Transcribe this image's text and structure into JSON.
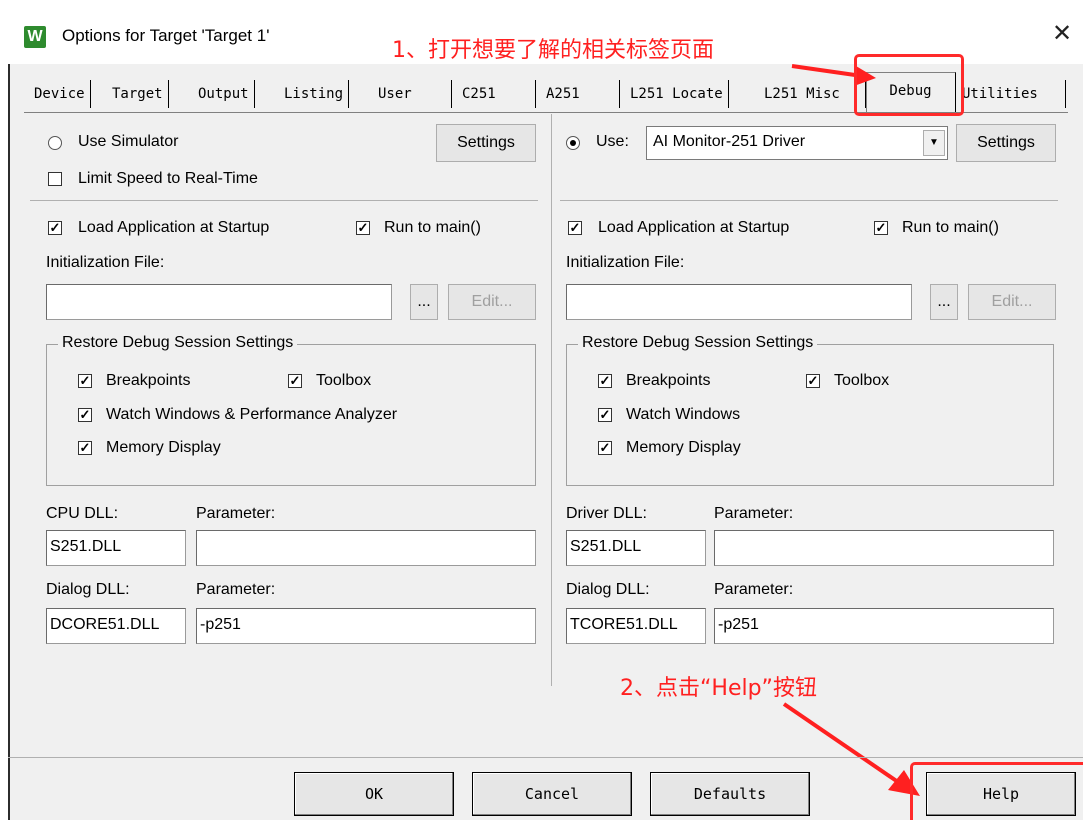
{
  "window": {
    "title": "Options for Target 'Target 1'",
    "icon": "W",
    "close_glyph": "✕"
  },
  "annotations": {
    "step1": "1、打开想要了解的相关标签页面",
    "step2": "2、点击“Help”按钮",
    "color": "#ff2020"
  },
  "tabs": [
    {
      "label": "Device"
    },
    {
      "label": "Target"
    },
    {
      "label": "Output"
    },
    {
      "label": "Listing"
    },
    {
      "label": "User"
    },
    {
      "label": "C251"
    },
    {
      "label": "A251"
    },
    {
      "label": "L251 Locate"
    },
    {
      "label": "L251 Misc"
    },
    {
      "label": "Debug",
      "active": true
    },
    {
      "label": "Utilities"
    }
  ],
  "left": {
    "use_simulator": "Use Simulator",
    "settings": "Settings",
    "limit_speed": "Limit Speed to Real-Time",
    "load_app": "Load Application at Startup",
    "run_to_main": "Run to main()",
    "init_file_label": "Initialization File:",
    "init_file_value": "",
    "browse": "...",
    "edit": "Edit...",
    "restore_group": "Restore Debug Session Settings",
    "breakpoints": "Breakpoints",
    "toolbox": "Toolbox",
    "watch": "Watch Windows & Performance Analyzer",
    "memory": "Memory Display",
    "cpu_dll_label": "CPU DLL:",
    "parameter_label": "Parameter:",
    "cpu_dll_value": "S251.DLL",
    "cpu_param_value": "",
    "dialog_dll_label": "Dialog DLL:",
    "dialog_param_label": "Parameter:",
    "dialog_dll_value": "DCORE51.DLL",
    "dialog_param_value": "-p251"
  },
  "right": {
    "use": "Use:",
    "driver_select": "AI Monitor-251 Driver",
    "settings": "Settings",
    "load_app": "Load Application at Startup",
    "run_to_main": "Run to main()",
    "init_file_label": "Initialization File:",
    "init_file_value": "",
    "browse": "...",
    "edit": "Edit...",
    "restore_group": "Restore Debug Session Settings",
    "breakpoints": "Breakpoints",
    "toolbox": "Toolbox",
    "watch": "Watch Windows",
    "memory": "Memory Display",
    "driver_dll_label": "Driver DLL:",
    "parameter_label": "Parameter:",
    "driver_dll_value": "S251.DLL",
    "driver_param_value": "",
    "dialog_dll_label": "Dialog DLL:",
    "dialog_param_label": "Parameter:",
    "dialog_dll_value": "TCORE51.DLL",
    "dialog_param_value": "-p251"
  },
  "buttons": {
    "ok": "OK",
    "cancel": "Cancel",
    "defaults": "Defaults",
    "help": "Help"
  },
  "check_glyph": "✓"
}
